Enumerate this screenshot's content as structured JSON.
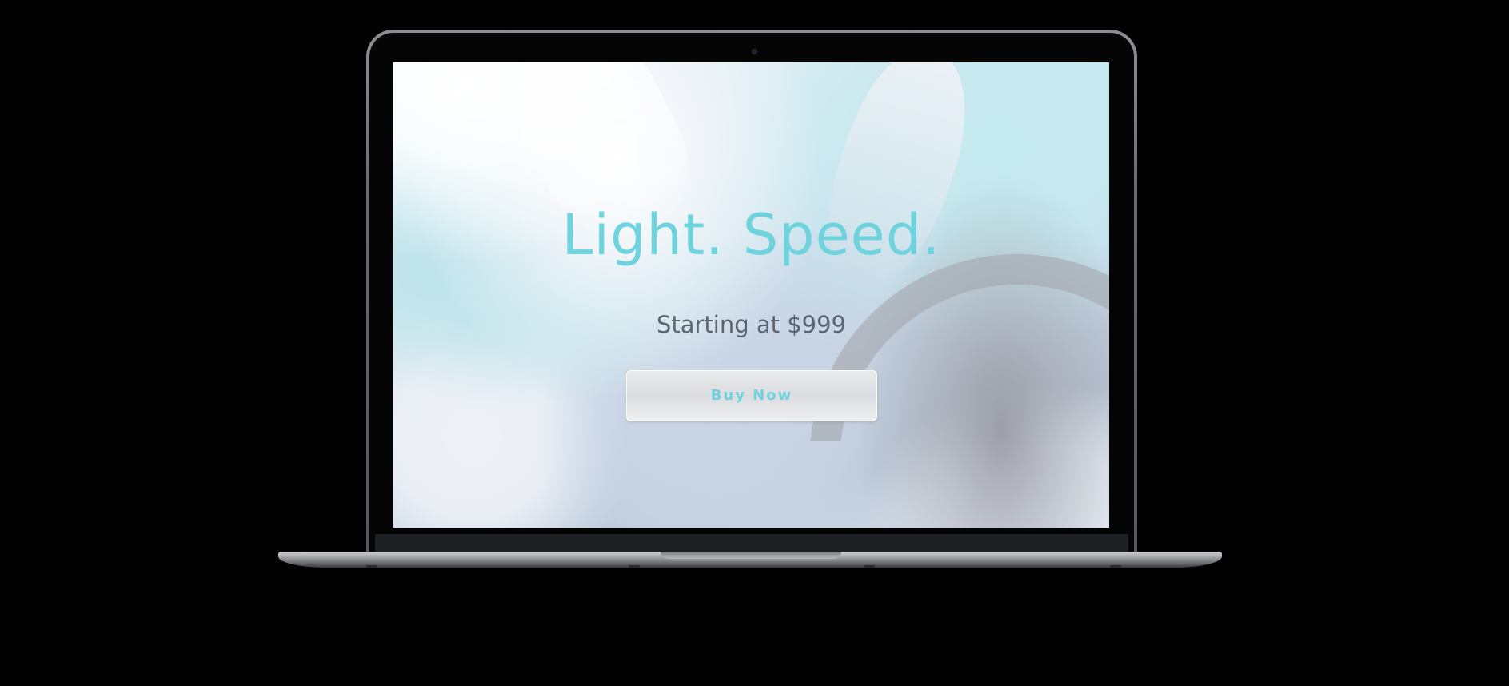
{
  "hero": {
    "headline": "Light. Speed.",
    "subline": "Starting at $999",
    "buy_button_label": "Buy Now"
  },
  "colors": {
    "accent": "#6fd3de",
    "subtext": "#5c6470",
    "background": "#000000",
    "button_bg": "#e4e5e7"
  },
  "icons": {
    "camera": "camera-dot-icon"
  }
}
